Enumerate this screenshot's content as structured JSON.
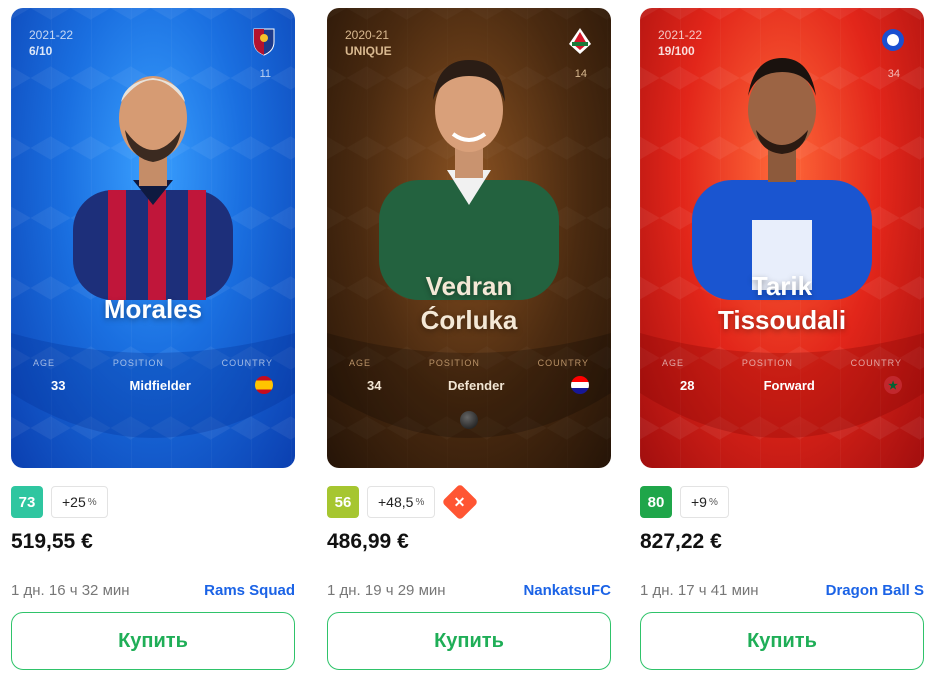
{
  "cards": [
    {
      "season": "2021-22",
      "serial": "6/10",
      "jersey": "11",
      "name_line1": "Morales",
      "name_line2": "",
      "age_label": "AGE",
      "position_label": "POSITION",
      "country_label": "COUNTRY",
      "age": "33",
      "position": "Midfielder",
      "country_flag": "spain-flag",
      "score": "73",
      "score_color": "#2fc6a0",
      "trend": "+25",
      "trend_unit": "%",
      "price": "519,55 €",
      "time_left": "1 дн. 16 ч 32 мин",
      "seller": "Rams Squad",
      "buy_label": "Купить"
    },
    {
      "season": "2020-21",
      "serial": "UNIQUE",
      "jersey": "14",
      "name_line1": "Vedran",
      "name_line2": "Ćorluka",
      "age_label": "AGE",
      "position_label": "POSITION",
      "country_label": "COUNTRY",
      "age": "34",
      "position": "Defender",
      "country_flag": "croatia-flag",
      "score": "56",
      "score_color": "#a6c630",
      "trend": "+48,5",
      "trend_unit": "%",
      "price": "486,99 €",
      "time_left": "1 дн. 19 ч 29 мин",
      "seller": "NankatsuFC",
      "buy_label": "Купить"
    },
    {
      "season": "2021-22",
      "serial": "19/100",
      "jersey": "34",
      "name_line1": "Tarik",
      "name_line2": "Tissoudali",
      "age_label": "AGE",
      "position_label": "POSITION",
      "country_label": "COUNTRY",
      "age": "28",
      "position": "Forward",
      "country_flag": "morocco-flag",
      "score": "80",
      "score_color": "#1fa64a",
      "trend": "+9",
      "trend_unit": "%",
      "price": "827,22 €",
      "time_left": "1 дн. 17 ч 41 мин",
      "seller": "Dragon Ball S",
      "buy_label": "Купить"
    }
  ]
}
